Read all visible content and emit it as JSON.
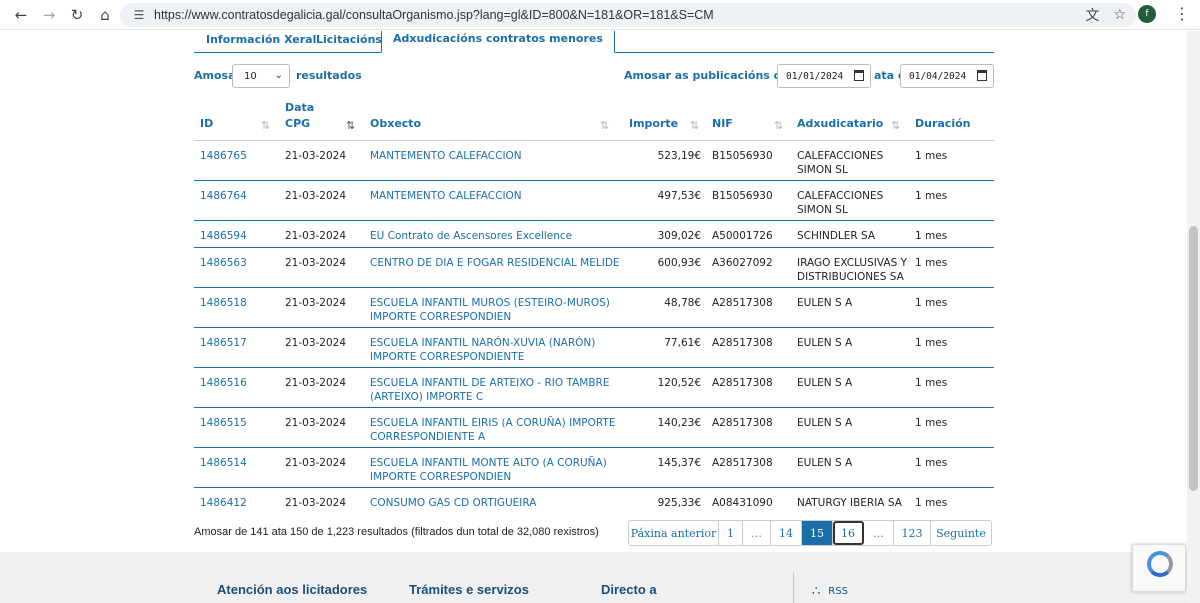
{
  "browser": {
    "url": "https://www.contratosdegalicia.gal/consultaOrganismo.jsp?lang=gl&ID=800&N=181&OR=181&S=CM",
    "avatar_letter": "f"
  },
  "tabs": [
    {
      "label": "Información Xeral"
    },
    {
      "label": "Licitacións"
    },
    {
      "label": "Adxudicacións contratos menores"
    }
  ],
  "controls": {
    "show_label": "Amosar",
    "page_size": "10",
    "results_label": "resultados",
    "date_from_label": "Amosar as publicacións dende o",
    "date_from": "01/01/2024",
    "date_to_label": "ata o",
    "date_to": "01/04/2024"
  },
  "table": {
    "headers": {
      "id": "ID",
      "date_line1": "Data",
      "date_line2": "CPG",
      "object": "Obxecto",
      "amount": "Importe",
      "nif": "NIF",
      "awardee": "Adxudicatario",
      "duration": "Duración"
    },
    "rows": [
      {
        "id": "1486765",
        "date": "21-03-2024",
        "obj1": "MANTEMENTO CALEFACCION",
        "obj2": "",
        "amount": "523,19€",
        "nif": "B15056930",
        "aw1": "CALEFACCIONES",
        "aw2": "SIMON SL",
        "duration": "1 mes"
      },
      {
        "id": "1486764",
        "date": "21-03-2024",
        "obj1": "MANTEMENTO CALEFACCION",
        "obj2": "",
        "amount": "497,53€",
        "nif": "B15056930",
        "aw1": "CALEFACCIONES",
        "aw2": "SIMON SL",
        "duration": "1 mes"
      },
      {
        "id": "1486594",
        "date": "21-03-2024",
        "obj1": "EU Contrato de Ascensores Excellence",
        "obj2": "",
        "amount": "309,02€",
        "nif": "A50001726",
        "aw1": "SCHINDLER SA",
        "aw2": "",
        "duration": "1 mes"
      },
      {
        "id": "1486563",
        "date": "21-03-2024",
        "obj1": "CENTRO DE DIA E FOGAR RESIDENCIAL MELIDE",
        "obj2": "",
        "amount": "600,93€",
        "nif": "A36027092",
        "aw1": "IRAGO EXCLUSIVAS Y",
        "aw2": "DISTRIBUCIONES SA",
        "duration": "1 mes"
      },
      {
        "id": "1486518",
        "date": "21-03-2024",
        "obj1": "ESCUELA INFANTIL MUROS (ESTEIRO-MUROS)",
        "obj2": "IMPORTE CORRESPONDIEN",
        "amount": "48,78€",
        "nif": "A28517308",
        "aw1": "EULEN S A",
        "aw2": "",
        "duration": "1 mes"
      },
      {
        "id": "1486517",
        "date": "21-03-2024",
        "obj1": "ESCUELA INFANTIL NARÓN-XUVIA (NARÓN)",
        "obj2": "IMPORTE CORRESPONDIENTE",
        "amount": "77,61€",
        "nif": "A28517308",
        "aw1": "EULEN S A",
        "aw2": "",
        "duration": "1 mes"
      },
      {
        "id": "1486516",
        "date": "21-03-2024",
        "obj1": "ESCUELA INFANTIL DE ARTEIXO - RIO TAMBRE",
        "obj2": "(ARTEIXO) IMPORTE C",
        "amount": "120,52€",
        "nif": "A28517308",
        "aw1": "EULEN S A",
        "aw2": "",
        "duration": "1 mes"
      },
      {
        "id": "1486515",
        "date": "21-03-2024",
        "obj1": "ESCUELA INFANTIL EIRIS (A CORUÑA) IMPORTE",
        "obj2": "CORRESPONDIENTE A",
        "amount": "140,23€",
        "nif": "A28517308",
        "aw1": "EULEN S A",
        "aw2": "",
        "duration": "1 mes"
      },
      {
        "id": "1486514",
        "date": "21-03-2024",
        "obj1": "ESCUELA INFANTIL MONTE ALTO (A CORUÑA)",
        "obj2": "IMPORTE CORRESPONDIEN",
        "amount": "145,37€",
        "nif": "A28517308",
        "aw1": "EULEN S A",
        "aw2": "",
        "duration": "1 mes"
      },
      {
        "id": "1486412",
        "date": "21-03-2024",
        "obj1": "CONSUMO GAS CD ORTIGUEIRA",
        "obj2": "",
        "amount": "925,33€",
        "nif": "A08431090",
        "aw1": "NATURGY IBERIA SA",
        "aw2": "",
        "duration": "1 mes"
      }
    ]
  },
  "summary": "Amosar de 141 ata 150 de 1,223 resultados (filtrados dun total de 32,080 rexistros)",
  "pager": {
    "prev": "Páxina anterior",
    "p1": "1",
    "dots1": "…",
    "p14": "14",
    "p15": "15",
    "p16": "16",
    "dots2": "…",
    "p123": "123",
    "next": "Seguinte"
  },
  "footer": {
    "col1": "Atención aos licitadores",
    "col2": "Trámites e servizos",
    "col3": "Directo a",
    "rss": "RSS"
  }
}
